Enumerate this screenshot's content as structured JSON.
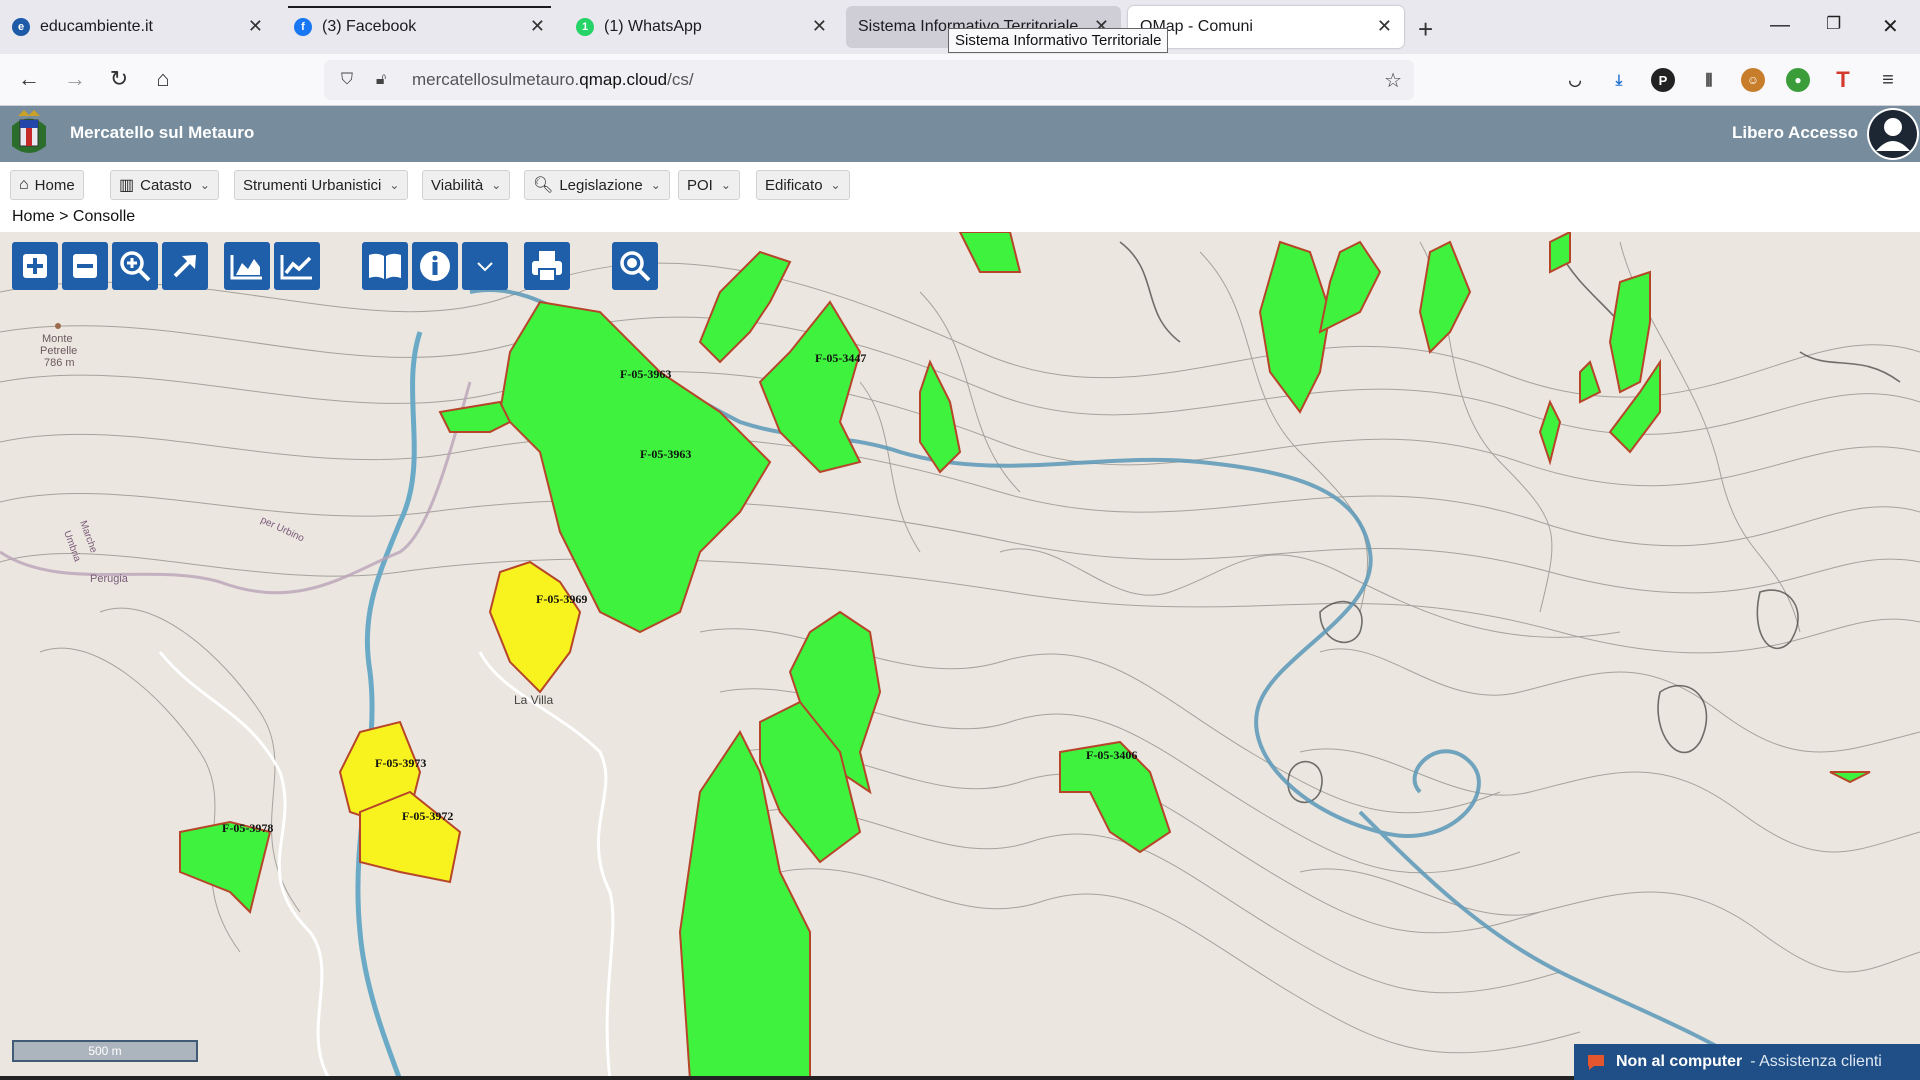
{
  "browser": {
    "tabs": [
      {
        "label": "educambiente.it",
        "icon": "educambiente-favicon",
        "state": "normal"
      },
      {
        "label": "(3) Facebook",
        "icon": "facebook-favicon",
        "state": "normal"
      },
      {
        "label": "(1) WhatsApp",
        "icon": "whatsapp-favicon",
        "state": "normal"
      },
      {
        "label": "Sistema Informativo Territoriale",
        "icon": "none",
        "state": "hover"
      },
      {
        "label": "QMap - Comuni",
        "icon": "none",
        "state": "active"
      }
    ],
    "tooltip": "Sistema Informativo Territoriale",
    "url_prefix": "mercatellosulmetauro.",
    "url_domain": "qmap.cloud",
    "url_suffix": "/cs/",
    "colors": {
      "tabbar": "#e9e8ee",
      "active_tab": "#ffffff"
    }
  },
  "app": {
    "title": "Mercatello sul Metauro",
    "access_label": "Libero Accesso",
    "header_color": "#778c9c"
  },
  "menu": {
    "items": [
      {
        "label": "Home",
        "icon": "home-icon",
        "dropdown": false
      },
      {
        "label": "Catasto",
        "icon": "building-icon",
        "dropdown": true
      },
      {
        "label": "Strumenti Urbanistici",
        "icon": "",
        "dropdown": true
      },
      {
        "label": "Viabilità",
        "icon": "",
        "dropdown": true
      },
      {
        "label": "Legislazione",
        "icon": "search-icon",
        "dropdown": true
      },
      {
        "label": "POI",
        "icon": "",
        "dropdown": true
      },
      {
        "label": "Edificato",
        "icon": "",
        "dropdown": true
      }
    ]
  },
  "breadcrumb": {
    "text": "Home > Consolle"
  },
  "map": {
    "tools": [
      "zoom-in-icon",
      "zoom-out-icon",
      "zoom-area-icon",
      "full-extent-icon",
      "elevation-profile-icon",
      "line-chart-icon",
      "legend-book-icon",
      "info-icon",
      "dropdown-chevron-icon",
      "print-icon",
      "search-map-icon"
    ],
    "toolbar_color": "#1f5ea8",
    "scale_label": "500 m",
    "labels": {
      "monte_1": "Monte",
      "monte_2": "Petrelle",
      "monte_3": "786 m",
      "la_villa": "La Villa",
      "road_perugia": "Perugia",
      "road_urbino": "per Urbino",
      "road_marche": "Marche",
      "road_umbria": "Umbria"
    },
    "parcels": {
      "p1": "F-05-3963",
      "p2": "F-05-3963",
      "p3": "F-05-3447",
      "p4": "F-05-3969",
      "p5": "F-05-3973",
      "p6": "F-05-3972",
      "p7": "F-05-3978",
      "p8": "F-05-3406"
    },
    "colors": {
      "green_parcel": "#3ef23e",
      "yellow_parcel": "#f8f31e",
      "parcel_outline": "#b6452a",
      "river": "#5a98b8",
      "background": "#ebe6df"
    }
  },
  "chat": {
    "title": "Non al computer",
    "subtitle": "- Assistenza clienti"
  }
}
